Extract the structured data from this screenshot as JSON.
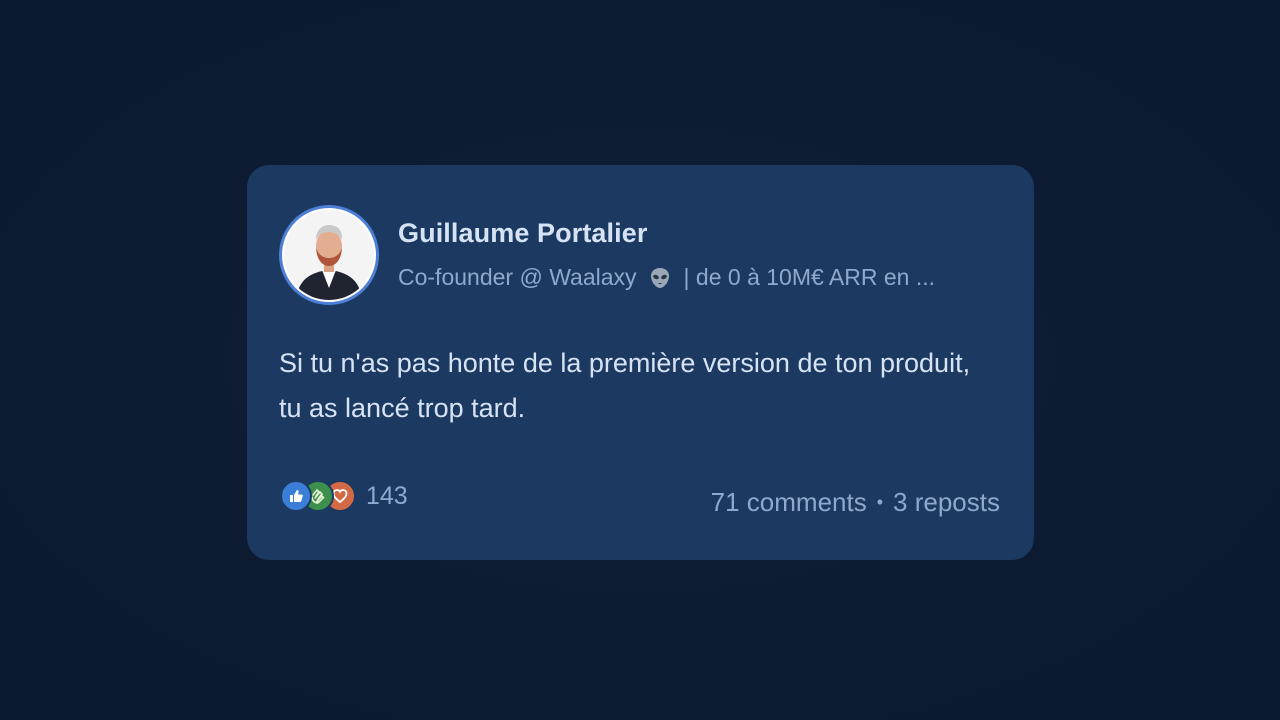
{
  "post": {
    "author": {
      "name": "Guillaume Portalier",
      "headline_start": "Co-founder @ Waalaxy",
      "headline_icon": "alien-emoji-icon",
      "headline_end": "| de 0 à 10M€ ARR en ..."
    },
    "text": "Si tu n'as pas honte de la première version de ton produit, tu as lancé trop tard.",
    "reactions": {
      "icons": [
        "like-icon",
        "clap-icon",
        "love-icon"
      ],
      "count": "143"
    },
    "comments": "71 comments",
    "separator": "•",
    "reposts": "3 reposts"
  },
  "colors": {
    "background": "#0e1d34",
    "card": "#1c3a61",
    "text_primary": "#d7e3f4",
    "text_secondary": "#8ea9cd",
    "like": "#3b7ed8",
    "clap": "#3d8f4d",
    "love": "#d46a45"
  }
}
